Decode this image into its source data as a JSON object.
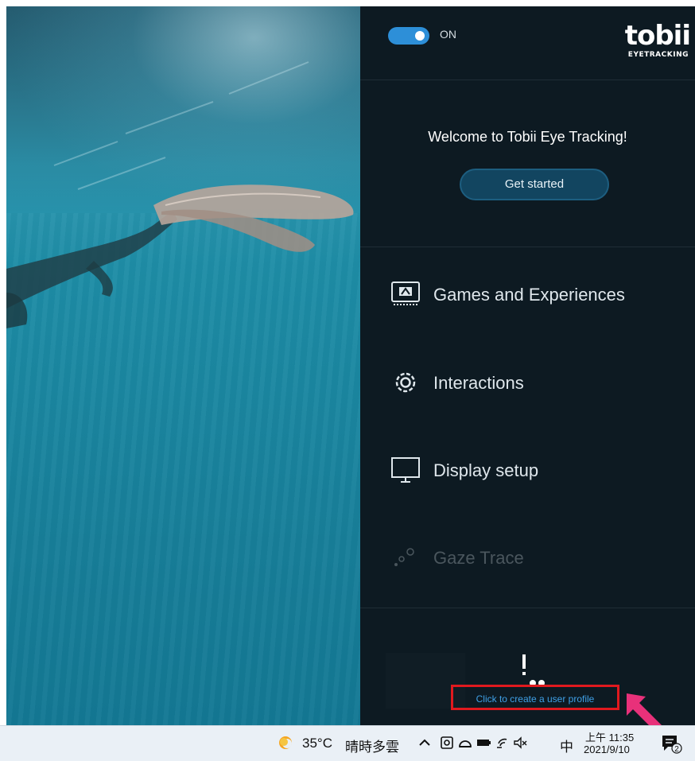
{
  "app": {
    "toggle_state_label": "ON",
    "brand": {
      "name": "tobii",
      "sub": "EYETRACKING"
    }
  },
  "welcome": {
    "message": "Welcome to Tobii Eye Tracking!",
    "button_label": "Get started"
  },
  "menu": {
    "items": [
      {
        "label": "Games and Experiences",
        "icon": "games-icon",
        "enabled": true
      },
      {
        "label": "Interactions",
        "icon": "gear-icon",
        "enabled": true
      },
      {
        "label": "Display setup",
        "icon": "monitor-icon",
        "enabled": true
      },
      {
        "label": "Gaze Trace",
        "icon": "gaze-dots-icon",
        "enabled": false
      }
    ]
  },
  "profile": {
    "link_text": "Click to create a user profile",
    "icon": "profile-warning-icon"
  },
  "taskbar": {
    "weather_temp": "35°C",
    "weather_desc": "晴時多雲",
    "ime_label": "中",
    "time": "上午 11:35",
    "date": "2021/9/10",
    "notification_count": "2"
  },
  "colors": {
    "panel_bg": "#0d1a22",
    "accent_blue": "#2d8fd8",
    "link_blue": "#3fa0e6",
    "highlight_red": "#e0191e",
    "arrow_pink": "#e8317a"
  }
}
